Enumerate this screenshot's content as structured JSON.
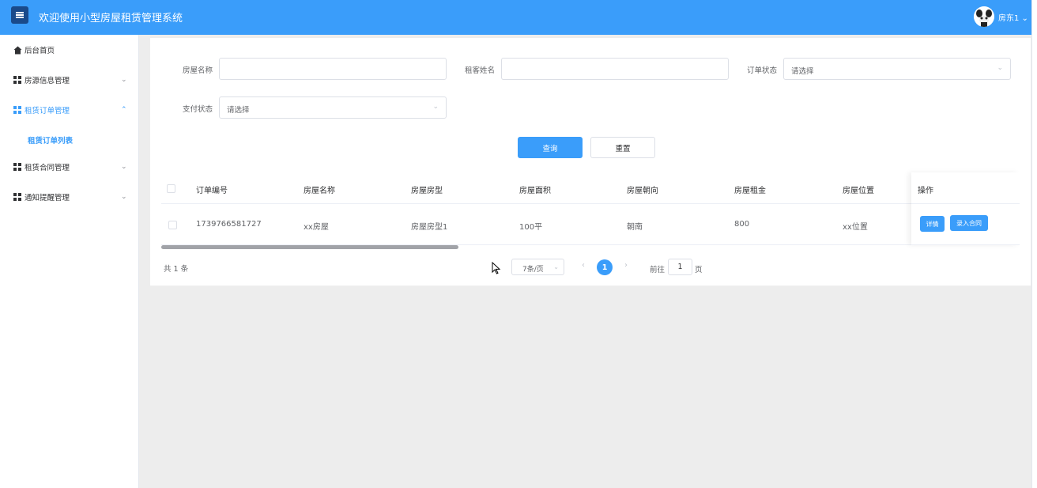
{
  "header": {
    "title": "欢迎使用小型房屋租赁管理系统",
    "user": "房东1"
  },
  "sidebar": {
    "items": [
      {
        "label": "后台首页"
      },
      {
        "label": "房源信息管理"
      },
      {
        "label": "租赁订单管理"
      },
      {
        "label": "租赁合同管理"
      },
      {
        "label": "通知提醒管理"
      }
    ],
    "sub_item": "租赁订单列表"
  },
  "filters": {
    "house_name": {
      "label": "房屋名称",
      "value": ""
    },
    "tenant_name": {
      "label": "租客姓名",
      "value": ""
    },
    "order_status": {
      "label": "订单状态",
      "placeholder": "请选择"
    },
    "pay_status": {
      "label": "支付状态",
      "placeholder": "请选择"
    },
    "query_label": "查询",
    "reset_label": "重置"
  },
  "table": {
    "headers": [
      "订单编号",
      "房屋名称",
      "房屋房型",
      "房屋面积",
      "房屋朝向",
      "房屋租金",
      "房屋位置",
      "操作"
    ],
    "rows": [
      {
        "cells": [
          "1739766581727",
          "xx房屋",
          "房屋房型1",
          "100平",
          "朝南",
          "800",
          "xx位置"
        ],
        "actions": [
          "详情",
          "录入合同"
        ]
      }
    ]
  },
  "pagination": {
    "total_text": "共 1 条",
    "page_size": "7条/页",
    "current_page": "1",
    "goto_label": "前往",
    "goto_value": "1",
    "goto_unit": "页"
  },
  "colors": {
    "primary": "#3a9dfa",
    "header_bg": "#3a9dfa",
    "content_bg": "#ededed"
  }
}
